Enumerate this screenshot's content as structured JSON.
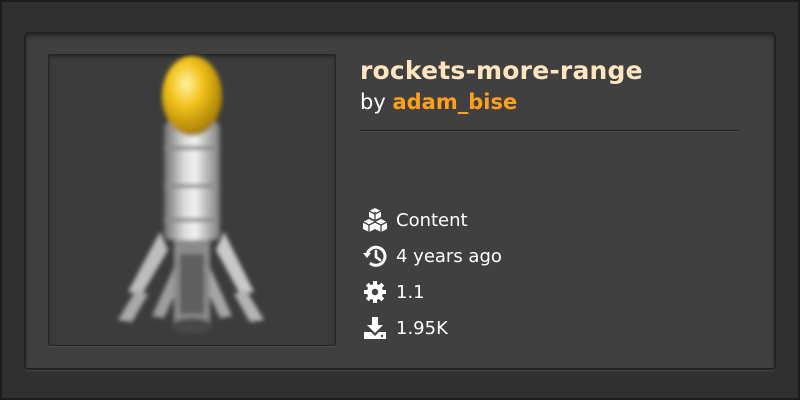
{
  "mod": {
    "title": "rockets-more-range",
    "by_prefix": "by",
    "author": "adam_bise",
    "thumbnail_icon": "rocket-icon"
  },
  "meta": [
    {
      "icon": "cubes-icon",
      "label": "Content"
    },
    {
      "icon": "history-icon",
      "label": "4 years ago"
    },
    {
      "icon": "gear-icon",
      "label": "1.1"
    },
    {
      "icon": "download-icon",
      "label": "1.95K"
    }
  ],
  "colors": {
    "background": "#313031",
    "card": "#414041",
    "title": "#ffe6c0",
    "author": "#ff9f1b",
    "text": "#ffffff"
  }
}
